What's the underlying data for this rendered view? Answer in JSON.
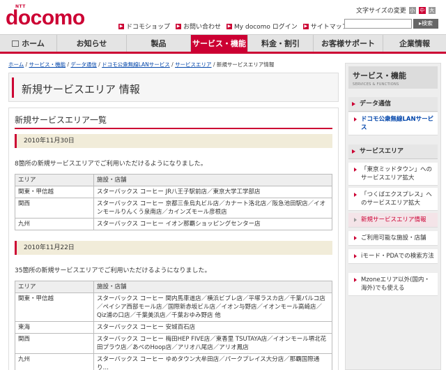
{
  "header": {
    "logo_ntt": "NTT",
    "logo_brand": "docomo",
    "util_links": [
      {
        "label": "ドコモショップ"
      },
      {
        "label": "お問い合わせ"
      },
      {
        "label": "My docomo ログイン"
      },
      {
        "label": "サイトマップ"
      }
    ],
    "font_size_label": "文字サイズの変更",
    "font_sizes": [
      "小",
      "中",
      "大"
    ],
    "search_placeholder": "",
    "search_button": "検索"
  },
  "nav": {
    "tabs": [
      {
        "label": "ホーム"
      },
      {
        "label": "お知らせ"
      },
      {
        "label": "製品"
      },
      {
        "label": "サービス・機能"
      },
      {
        "label": "料金・割引"
      },
      {
        "label": "お客様サポート"
      },
      {
        "label": "企業情報"
      }
    ]
  },
  "breadcrumb": {
    "items": [
      "ホーム",
      "サービス・機能",
      "データ通信",
      "ドコモ公衆無線LANサービス",
      "サービスエリア"
    ],
    "current": "新規サービスエリア情報"
  },
  "main": {
    "page_title": "新規サービスエリア 情報",
    "section_title": "新規サービスエリア一覧",
    "col_area": "エリア",
    "col_facility": "施設・店舗",
    "updates": [
      {
        "date": "2010年11月30日",
        "notice": "8箇所の新規サービスエリアでご利用いただけるようになりました。",
        "rows": [
          {
            "area": "関東・甲信越",
            "facility": "スターバックス コーヒー JR八王子駅前店／東京大学工学部店"
          },
          {
            "area": "関西",
            "facility": "スターバックス コーヒー 京都三条烏丸ビル店／カナート洛北店／阪急池田駅店／イオンモールりんくう泉南店／カインズモール彦根店"
          },
          {
            "area": "九州",
            "facility": "スターバックス コーヒー イオン那覇ショッピングセンター店"
          }
        ]
      },
      {
        "date": "2010年11月22日",
        "notice": "35箇所の新規サービスエリアでご利用いただけるようになりました。",
        "rows": [
          {
            "area": "関東・甲信越",
            "facility": "スターバックス コーヒー 関内馬車道店／横浜ビブレ店／平塚ラスカ店／千葉パルコ店／ペイシア西部モール店／国際新赤坂ビル店／イオン与野店／イオンモール高崎店／Qiz浦の口店／千葉美浜店／千葉おゆみ野店 他"
          },
          {
            "area": "東海",
            "facility": "スターバックス コーヒー 安城百石店"
          },
          {
            "area": "関西",
            "facility": "スターバックス コーヒー 梅田HEP FIVE店／東香里 TSUTAYA店／イオンモール堺北花田プラウ店／あべのHoop店／アリオ八尾店／アリオ鳳店"
          },
          {
            "area": "九州",
            "facility": "スターバックス コーヒー ゆめタウン大牟田店／パークプレイス大分店／那覇国際通り…"
          }
        ]
      }
    ]
  },
  "sidebar": {
    "title": "サービス・機能",
    "subtitle": "SERVICES & FUNCTIONS",
    "cat_data": "データ通信",
    "link_wifi": "ドコモ公衆無線LANサービス",
    "cat_area": "サービスエリア",
    "links": [
      {
        "label": "「東京ミッドタウン」へのサービスエリア拡大"
      },
      {
        "label": "「つくばエクスプレス」へのサービスエリア拡大"
      },
      {
        "label": "新規サービスエリア情報"
      },
      {
        "label": "ご利用可能な施設・店舗"
      },
      {
        "label": "iモード・PDAでの検索方法"
      },
      {
        "label": "Mzoneエリア以外(国内・海外)でも使える"
      }
    ]
  },
  "colors": {
    "accent": "#cc0033",
    "link": "#0044aa",
    "date_bar": "#f1ecd9"
  }
}
